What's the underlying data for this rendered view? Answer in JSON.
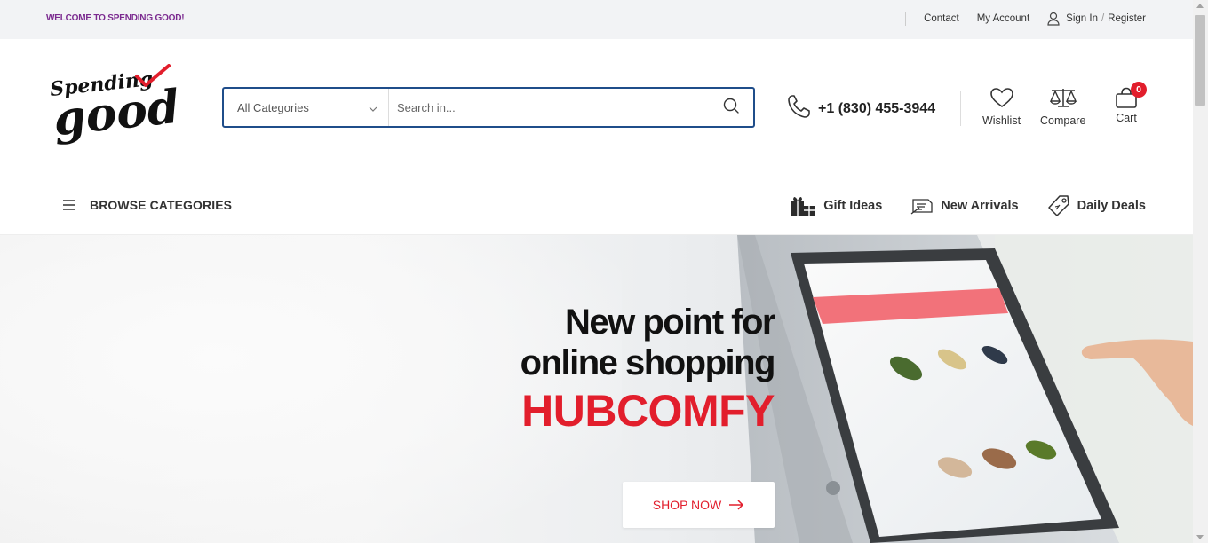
{
  "topbar": {
    "welcome": "WELCOME TO SPENDING GOOD!",
    "contact": "Contact",
    "my_account": "My Account",
    "sign_in": "Sign In",
    "slash": "/",
    "register": "Register"
  },
  "logo": {
    "line1": "Spending",
    "line2": "good",
    "check_color": "#e21e2c"
  },
  "search": {
    "category_selected": "All Categories",
    "placeholder": "Search in..."
  },
  "phone": {
    "number": "+1 (830) 455-3944"
  },
  "header_icons": {
    "wishlist": "Wishlist",
    "compare": "Compare",
    "cart": "Cart",
    "cart_count": "0"
  },
  "nav": {
    "browse": "BROWSE CATEGORIES",
    "links": [
      {
        "label": "Gift Ideas",
        "icon": "gift-icon"
      },
      {
        "label": "New Arrivals",
        "icon": "new-arrivals-icon"
      },
      {
        "label": "Daily Deals",
        "icon": "tag-icon"
      }
    ]
  },
  "hero": {
    "line1": "New point for",
    "line2": "online shopping",
    "brand": "HUBCOMFY",
    "cta": "SHOP NOW"
  },
  "colors": {
    "accent_red": "#e21e2c",
    "search_border": "#1f4d8a",
    "welcome_purple": "#7b2a8f"
  }
}
